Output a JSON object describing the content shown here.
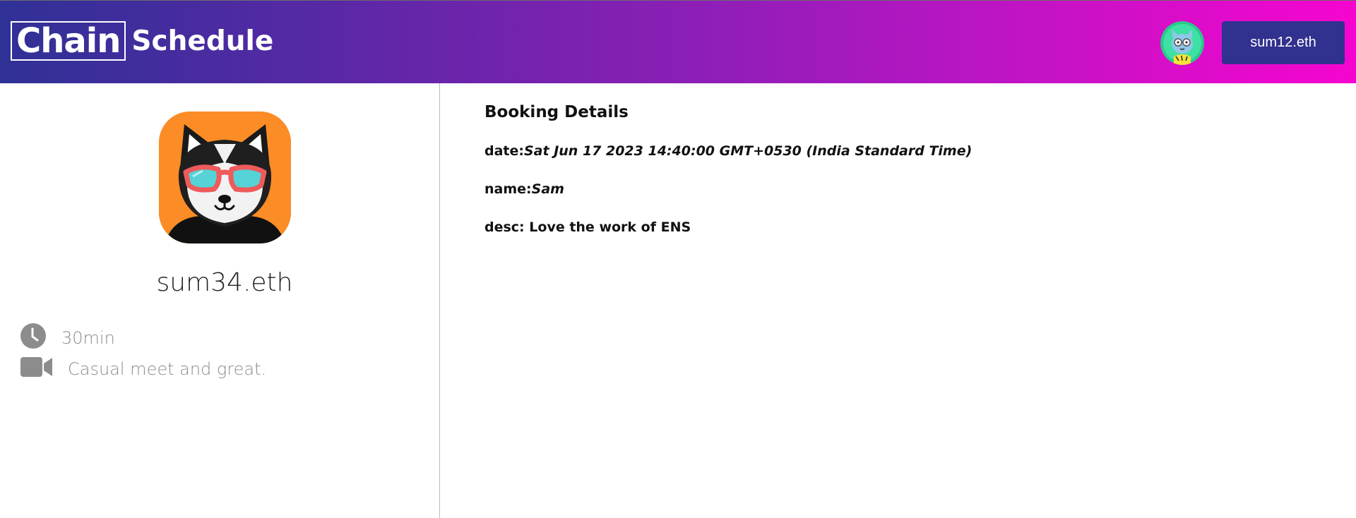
{
  "header": {
    "brand_boxed": "Chain",
    "brand_rest": "Schedule",
    "account_label": "sum12.eth",
    "avatar_icon": "cat-avatar-icon"
  },
  "host": {
    "avatar_icon": "husky-sunglasses-avatar-icon",
    "name": "sum34.eth",
    "duration": "30min",
    "description": "Casual meet and great.",
    "duration_icon": "clock-icon",
    "description_icon": "video-camera-icon"
  },
  "booking": {
    "title": "Booking Details",
    "date_label": "date:",
    "date_value": "Sat Jun 17 2023 14:40:00 GMT+0530 (India Standard Time)",
    "name_label": "name:",
    "name_value": "Sam",
    "desc_label": "desc: ",
    "desc_value": "Love the work of ENS"
  },
  "colors": {
    "header_gradient_start": "#2f3196",
    "header_gradient_end": "#f605cf",
    "account_button": "#31318f",
    "avatar_background": "#fb8c26",
    "meta_text": "#8c8c8c"
  }
}
